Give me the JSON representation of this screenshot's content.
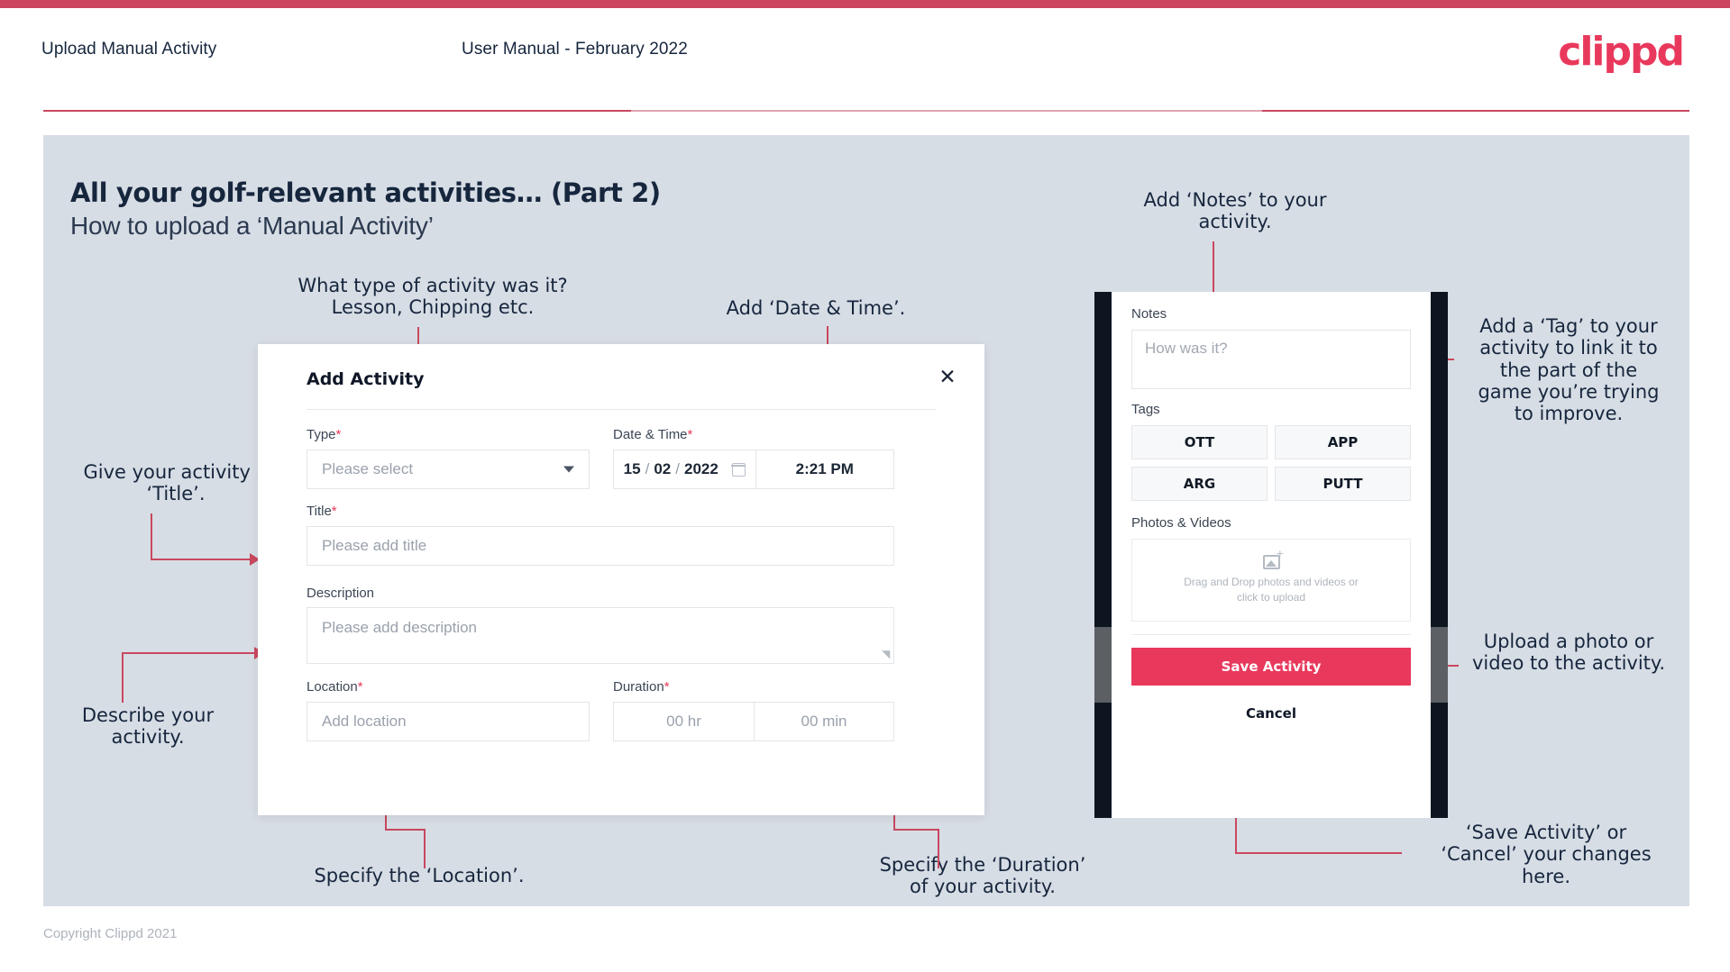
{
  "header": {
    "title": "Upload Manual Activity",
    "subtitle": "User Manual - February 2022",
    "logo": "clippd"
  },
  "slide": {
    "title": "All your golf-relevant activities… (Part 2)",
    "subtitle": "How to upload a ‘Manual Activity’",
    "footer": "Copyright Clippd 2021"
  },
  "dialog": {
    "title": "Add Activity",
    "close_icon": "close-icon",
    "fields": {
      "type": {
        "label": "Type",
        "required": "*",
        "placeholder": "Please select"
      },
      "datetime": {
        "label": "Date & Time",
        "required": "*",
        "day": "15",
        "month": "02",
        "year": "2022",
        "sep": "/",
        "time": "2:21 PM",
        "calendar_icon": "calendar-icon"
      },
      "title": {
        "label": "Title",
        "required": "*",
        "placeholder": "Please add title"
      },
      "description": {
        "label": "Description",
        "placeholder": "Please add description"
      },
      "location": {
        "label": "Location",
        "required": "*",
        "placeholder": "Add location"
      },
      "duration": {
        "label": "Duration",
        "required": "*",
        "hours": "00 hr",
        "minutes": "00 min"
      }
    }
  },
  "phone": {
    "notes": {
      "label": "Notes",
      "placeholder": "How was it?"
    },
    "tags": {
      "label": "Tags",
      "items": [
        "OTT",
        "APP",
        "ARG",
        "PUTT"
      ]
    },
    "photos": {
      "label": "Photos & Videos",
      "drop_line1": "Drag and Drop photos and videos or",
      "drop_line2": "click to upload",
      "icon": "image-add-icon"
    },
    "save_label": "Save Activity",
    "cancel_label": "Cancel"
  },
  "annotations": {
    "type": "What type of activity was it?\nLesson, Chipping etc.",
    "datetime": "Add ‘Date & Time’.",
    "title": "Give your activity a\n‘Title’.",
    "description": "Describe your\nactivity.",
    "location": "Specify the ‘Location’.",
    "duration": "Specify the ‘Duration’\nof your activity.",
    "notes": "Add ‘Notes’ to your\nactivity.",
    "tags": "Add a ‘Tag’ to your\nactivity to link it to\nthe part of the\ngame you’re trying\nto improve.",
    "upload": "Upload a photo or\nvideo to the activity.",
    "save": "‘Save Activity’ or\n‘Cancel’ your changes\nhere."
  },
  "colors": {
    "brand_pink": "#e8395c",
    "arrow_red": "#c9485f",
    "slide_bg": "#d7dde5",
    "navy": "#16263d"
  }
}
